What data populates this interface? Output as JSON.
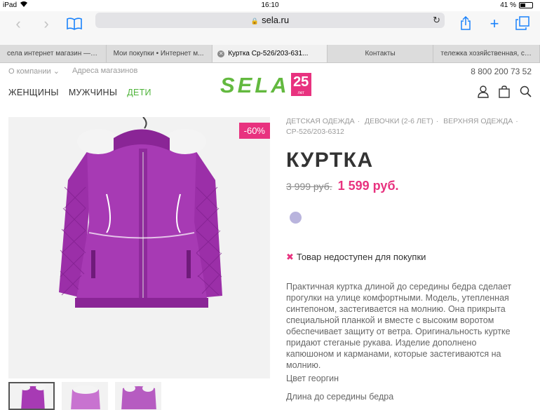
{
  "status": {
    "device": "iPad",
    "time": "16:10",
    "battery": "41 %"
  },
  "browser": {
    "url": "sela.ru",
    "tabs": [
      {
        "label": "села интернет магазин — Я..."
      },
      {
        "label": "Мои покупки • Интернет м..."
      },
      {
        "label": "Куртка Ср-526/203-631..."
      },
      {
        "label": "Контакты"
      },
      {
        "label": "тележка хозяйственная, ск..."
      }
    ]
  },
  "header": {
    "about": "О компании",
    "stores": "Адреса магазинов",
    "phone": "8 800 200 73 52",
    "nav": {
      "women": "ЖЕНЩИНЫ",
      "men": "МУЖЧИНЫ",
      "kids": "ДЕТИ"
    },
    "logo": {
      "word": "SELA",
      "years_num": "25",
      "years_word": "лет"
    }
  },
  "product": {
    "breadcrumbs": [
      "ДЕТСКАЯ ОДЕЖДА",
      "ДЕВОЧКИ (2-6 ЛЕТ)",
      "ВЕРХНЯЯ ОДЕЖДА",
      "СР-526/203-6312"
    ],
    "title": "КУРТКА",
    "old_price": "3 999 руб.",
    "new_price": "1 599 руб.",
    "discount": "-60%",
    "swatch_color": "#b9b4dd",
    "availability": "Товар недоступен для покупки",
    "description": "Практичная куртка длиной до середины бедра сделает прогулки на улице комфортными. Модель, утепленная синтепоном, застегивается на молнию. Она прикрыта специальной планкой и вместе с высоким воротом обеспечивает защиту от ветра. Оригинальность куртке придают стеганые рукава. Изделие дополнено капюшоном и карманами, которые застегиваются на молнию.",
    "color": "Цвет георгин",
    "length": "Длина до середины бедра"
  },
  "colors": {
    "accent": "#e8327f",
    "brand_green": "#63b93f",
    "jacket": "#9b2fa8"
  }
}
